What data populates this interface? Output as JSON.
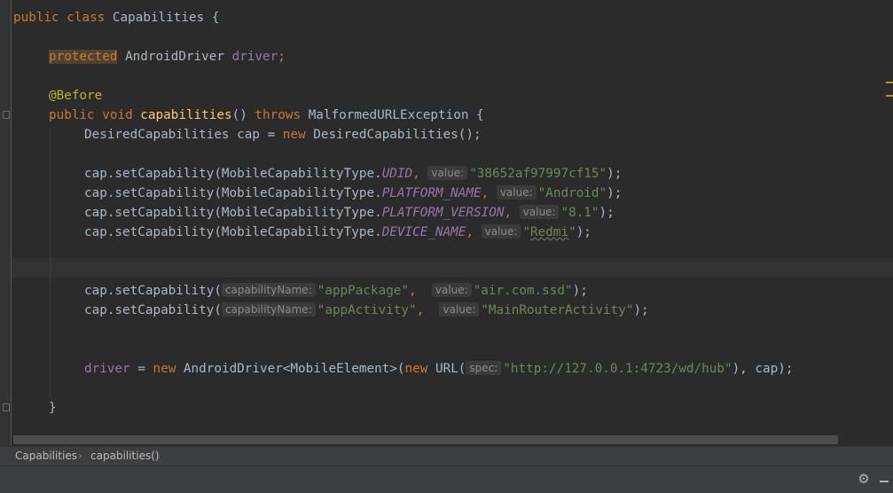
{
  "code": {
    "class_decl": [
      "public class",
      "Capabilities",
      "{"
    ],
    "field": {
      "keyword": "protected",
      "type": "AndroidDriver",
      "name": "driver",
      "end": ";"
    },
    "annotation": "@Before",
    "method": {
      "modifiers": "public void",
      "name": "capabilities",
      "params": "()",
      "throws_kw": "throws",
      "exception": "MalformedURLException {"
    },
    "cap_decl": {
      "type": "DesiredCapabilities cap = ",
      "kw": "new",
      "ctor": "DesiredCapabilities();"
    },
    "set_calls": [
      {
        "prefix": "cap.setCapability(MobileCapabilityType.",
        "const": "UDID",
        "sep": ", ",
        "hint": "value:",
        "value": "\"38652af97997cf15\"",
        "end": ");"
      },
      {
        "prefix": "cap.setCapability(MobileCapabilityType.",
        "const": "PLATFORM_NAME",
        "sep": ", ",
        "hint": "value:",
        "value": "\"Android\"",
        "end": ");"
      },
      {
        "prefix": "cap.setCapability(MobileCapabilityType.",
        "const": "PLATFORM_VERSION",
        "sep": ", ",
        "hint": "value:",
        "value": "\"8.1\"",
        "end": ");"
      },
      {
        "prefix": "cap.setCapability(MobileCapabilityType.",
        "const": "DEVICE_NAME",
        "sep": ", ",
        "hint": "value:",
        "value_open": "\"",
        "value_word": "Redmi",
        "value_close": "\"",
        "end": ");"
      }
    ],
    "app_calls": [
      {
        "prefix": "cap.setCapability(",
        "hint1": "capabilityName:",
        "key": "\"appPackage\"",
        "sep": ", ",
        "hint2": "value:",
        "value": "\"air.com.ssd\"",
        "end": ");"
      },
      {
        "prefix": "cap.setCapability(",
        "hint1": "capabilityName:",
        "key": "\"appActivity\"",
        "sep": ", ",
        "hint2": "value:",
        "value": "\"MainRouterActivity\"",
        "end": ");"
      }
    ],
    "driver_line": {
      "field": "driver",
      "eq": " = ",
      "kw": "new",
      "ctor": "AndroidDriver<MobileElement>(",
      "kw2": "new",
      "url_ctor": "URL(",
      "hint": "spec:",
      "url": "\"http://127.0.0.1:4723/wd/hub\"",
      "end": "), cap);"
    },
    "close_brace": "}"
  },
  "breadcrumb": {
    "class": "Capabilities",
    "separator": "›",
    "method": "capabilities()"
  },
  "status": {
    "settings_icon": "gear-icon",
    "minimize_icon": "minimize-icon"
  },
  "colors": {
    "background": "#2b2b2b",
    "keyword": "#cc7832",
    "string": "#6a8759",
    "field": "#9876aa",
    "function": "#ffc66d",
    "annotation": "#bbb529"
  }
}
